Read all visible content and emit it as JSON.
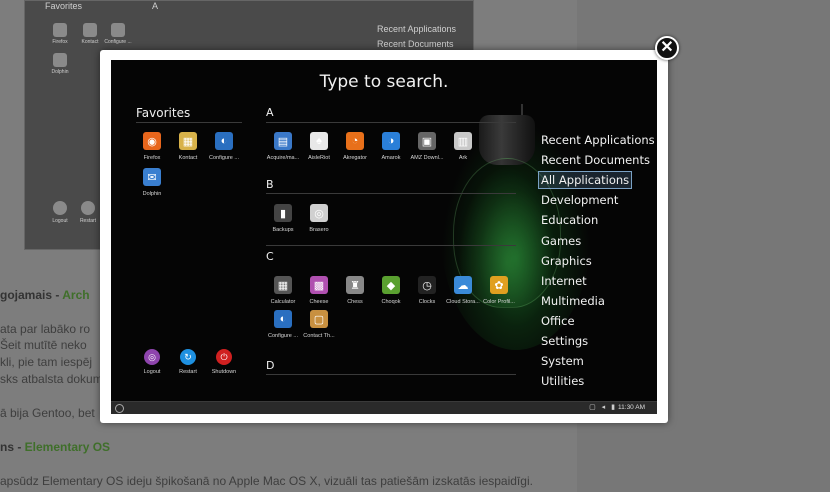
{
  "background_page": {
    "shot": {
      "favorites_label": "Favorites",
      "section_a_label": "A",
      "recent_applications": "Recent Applications",
      "recent_documents": "Recent Documents",
      "fav_captions": [
        "Firefox",
        "Kontact",
        "Configure ...",
        "Dolphin"
      ],
      "power_captions": [
        "Logout",
        "Restart"
      ]
    },
    "text_lines": [
      {
        "prefix": "gojamais - ",
        "link": "Arch"
      },
      {
        "prefix": "ata  par  labāko  ro",
        "link": ""
      },
      {
        "prefix": "Šeit mutītē neko ",
        "link": ""
      },
      {
        "prefix": "kli, pie tam iespēj",
        "link": ""
      },
      {
        "prefix": "sks atbalsta dokum",
        "link": ""
      },
      {
        "prefix": "ā bija Gentoo, bet",
        "link": ""
      },
      {
        "prefix": "ns - ",
        "link": "Elementary OS"
      },
      {
        "prefix": "apsūdz Elementary OS ideju špikošanā no Apple Mac OS X, vizuāli tas patiešām izskatās iespaidīgi.",
        "link": ""
      }
    ]
  },
  "lightbox": {
    "close_glyph": "✕",
    "launcher": {
      "search_prompt": "Type to search.",
      "favorites_heading": "Favorites",
      "favorites": [
        {
          "label": "Firefox",
          "icon": "firefox-icon",
          "color": "#e8661c",
          "glyph": "◉"
        },
        {
          "label": "Kontact",
          "icon": "kontact-icon",
          "color": "#d8b24a",
          "glyph": "▦"
        },
        {
          "label": "Configure ...",
          "icon": "configure-icon",
          "color": "#2a6fc0",
          "glyph": "◐"
        },
        {
          "label": "Dolphin",
          "icon": "dolphin-icon",
          "color": "#3a7fd0",
          "glyph": "✉"
        }
      ],
      "power": [
        {
          "label": "Logout",
          "icon": "logout-icon",
          "color": "#8e44ad",
          "glyph": "◎"
        },
        {
          "label": "Restart",
          "icon": "restart-icon",
          "color": "#1e90e0",
          "glyph": "↻"
        },
        {
          "label": "Shutdown",
          "icon": "shutdown-icon",
          "color": "#d02020",
          "glyph": "⏻"
        }
      ],
      "sections": [
        {
          "letter": "A",
          "apps": [
            {
              "label": "Acquire/ma...",
              "icon": "acquire-icon",
              "color": "#3a78c8",
              "glyph": "▤"
            },
            {
              "label": "AisleRiot",
              "icon": "aisleriot-icon",
              "color": "#e8e8e8",
              "glyph": "♠"
            },
            {
              "label": "Akregator",
              "icon": "akregator-icon",
              "color": "#e8701a",
              "glyph": "◔"
            },
            {
              "label": "Amarok",
              "icon": "amarok-icon",
              "color": "#2a7fd8",
              "glyph": "◑"
            },
            {
              "label": "AMZ Downl...",
              "icon": "amz-download-icon",
              "color": "#666666",
              "glyph": "▣"
            },
            {
              "label": "Ark",
              "icon": "ark-icon",
              "color": "#c8c8c8",
              "glyph": "▥"
            }
          ]
        },
        {
          "letter": "B",
          "apps": [
            {
              "label": "Backups",
              "icon": "backups-icon",
              "color": "#444444",
              "glyph": "▮"
            },
            {
              "label": "Brasero",
              "icon": "brasero-icon",
              "color": "#d0d0d0",
              "glyph": "◎"
            }
          ]
        },
        {
          "letter": "C",
          "apps": [
            {
              "label": "Calculator",
              "icon": "calculator-icon",
              "color": "#555555",
              "glyph": "▦"
            },
            {
              "label": "Cheese",
              "icon": "cheese-icon",
              "color": "#b050b0",
              "glyph": "▩"
            },
            {
              "label": "Chess",
              "icon": "chess-icon",
              "color": "#888888",
              "glyph": "♜"
            },
            {
              "label": "Choqok",
              "icon": "choqok-icon",
              "color": "#5aa030",
              "glyph": "◆"
            },
            {
              "label": "Clocks",
              "icon": "clocks-icon",
              "color": "#222222",
              "glyph": "◷"
            },
            {
              "label": "Cloud Stora...",
              "icon": "cloud-storage-icon",
              "color": "#3a8ad8",
              "glyph": "☁"
            },
            {
              "label": "Color Profil...",
              "icon": "color-profile-icon",
              "color": "#e0a020",
              "glyph": "✿"
            },
            {
              "label": "Configure ...",
              "icon": "configure2-icon",
              "color": "#2a6fc0",
              "glyph": "◐"
            },
            {
              "label": "Contact Th...",
              "icon": "contact-theme-icon",
              "color": "#c89040",
              "glyph": "▢"
            }
          ]
        },
        {
          "letter": "D",
          "apps": []
        }
      ],
      "categories": [
        "Recent Applications",
        "Recent Documents",
        "All Applications",
        "Development",
        "Education",
        "Games",
        "Graphics",
        "Internet",
        "Multimedia",
        "Office",
        "Settings",
        "System",
        "Utilities"
      ],
      "selected_category": "All Applications",
      "taskbar": {
        "tray_icons": "▢ ◂ ▮",
        "clock": "11:30 AM"
      }
    }
  }
}
